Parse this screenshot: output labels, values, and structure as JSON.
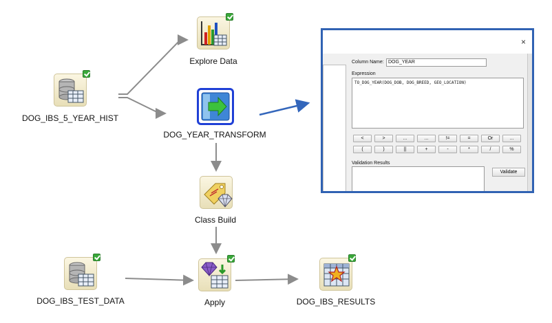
{
  "nodes": {
    "hist": {
      "label": "DOG_IBS_5_YEAR_HIST"
    },
    "explore": {
      "label": "Explore Data"
    },
    "transform": {
      "label": "DOG_YEAR_TRANSFORM"
    },
    "classbuild": {
      "label": "Class Build"
    },
    "testdata": {
      "label": "DOG_IBS_TEST_DATA"
    },
    "apply": {
      "label": "Apply"
    },
    "results": {
      "label": "DOG_IBS_RESULTS"
    }
  },
  "dialog": {
    "close": "×",
    "column_name_label": "Column Name:",
    "column_name_value": "DOG_YEAR",
    "expression_label": "Expression",
    "expression_value": "TO_DOG_YEAR(DOG_DOB, DOG_BREED, GEO_LOCATION)",
    "operators_row1": [
      "<",
      ">",
      "...",
      "...",
      "!=",
      "=",
      "Or",
      "..."
    ],
    "operators_row2": [
      "(",
      ")",
      "||",
      "+",
      "-",
      "*",
      "/",
      "%"
    ],
    "validation_label": "Validation Results",
    "validate_button": "Validate"
  },
  "colors": {
    "wire": "#8c8c8c",
    "link_arrow": "#3366bb",
    "selected_border": "#1f3fd6",
    "check": "#3aa83a"
  }
}
